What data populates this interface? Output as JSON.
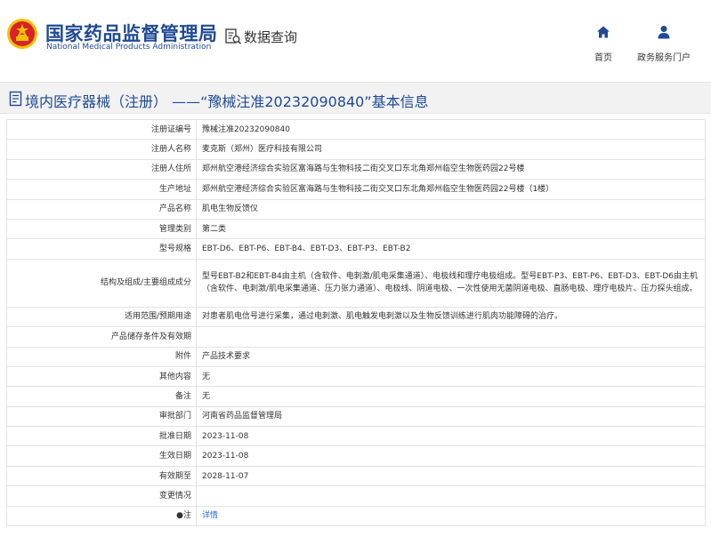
{
  "header": {
    "logo_cn": "国家药品监督管理局",
    "logo_en": "National Medical Products Administration",
    "query_label": "数据查询",
    "nav": [
      {
        "label": "首页",
        "icon": "home-icon"
      },
      {
        "label": "政务服务门户",
        "icon": "user-icon"
      }
    ]
  },
  "title": "境内医疗器械（注册） ——“豫械注准20232090840”基本信息",
  "colors": {
    "brand": "#1f4a94",
    "link": "#1f6fd1",
    "emblem_red": "#d8232a",
    "emblem_gold": "#f2c100"
  },
  "rows": [
    {
      "key": "注册证编号",
      "value": "豫械注准20232090840"
    },
    {
      "key": "注册人名称",
      "value": "麦克斯（郑州）医疗科技有限公司"
    },
    {
      "key": "注册人住所",
      "value": "郑州航空港经济综合实验区富海路与生物科技二街交叉口东北角郑州临空生物医药园22号楼"
    },
    {
      "key": "生产地址",
      "value": "郑州航空港经济综合实验区富海路与生物科技二街交叉口东北角郑州临空生物医药园22号楼（1楼）"
    },
    {
      "key": "产品名称",
      "value": "肌电生物反馈仪"
    },
    {
      "key": "管理类别",
      "value": "第二类"
    },
    {
      "key": "型号规格",
      "value": "EBT-D6、EBT-P6、EBT-B4、EBT-D3、EBT-P3、EBT-B2"
    },
    {
      "key": "结构及组成/主要组成成分",
      "value": "型号EBT-B2和EBT-B4由主机（含软件、电刺激/肌电采集通道）、电极线和理疗电极组成。型号EBT-P3、EBT-P6、EBT-D3、EBT-D6由主机（含软件、电刺激/肌电采集通道、压力张力通道）、电极线、阴道电极、一次性使用无菌阴道电极、直肠电极、理疗电极片、压力探头组成。"
    },
    {
      "key": "适用范围/预期用途",
      "value": "对患者肌电信号进行采集，通过电刺激、肌电触发电刺激以及生物反馈训练进行肌肉功能障碍的治疗。"
    },
    {
      "key": "产品储存条件及有效期",
      "value": ""
    },
    {
      "key": "附件",
      "value": "产品技术要求"
    },
    {
      "key": "其他内容",
      "value": "无"
    },
    {
      "key": "备注",
      "value": "无"
    },
    {
      "key": "审批部门",
      "value": "河南省药品监督管理局"
    },
    {
      "key": "批准日期",
      "value": "2023-11-08"
    },
    {
      "key": "生效日期",
      "value": "2023-11-08"
    },
    {
      "key": "有效期至",
      "value": "2028-11-07"
    },
    {
      "key": "变更情况",
      "value": ""
    },
    {
      "key": "●注",
      "value": "详情"
    }
  ]
}
